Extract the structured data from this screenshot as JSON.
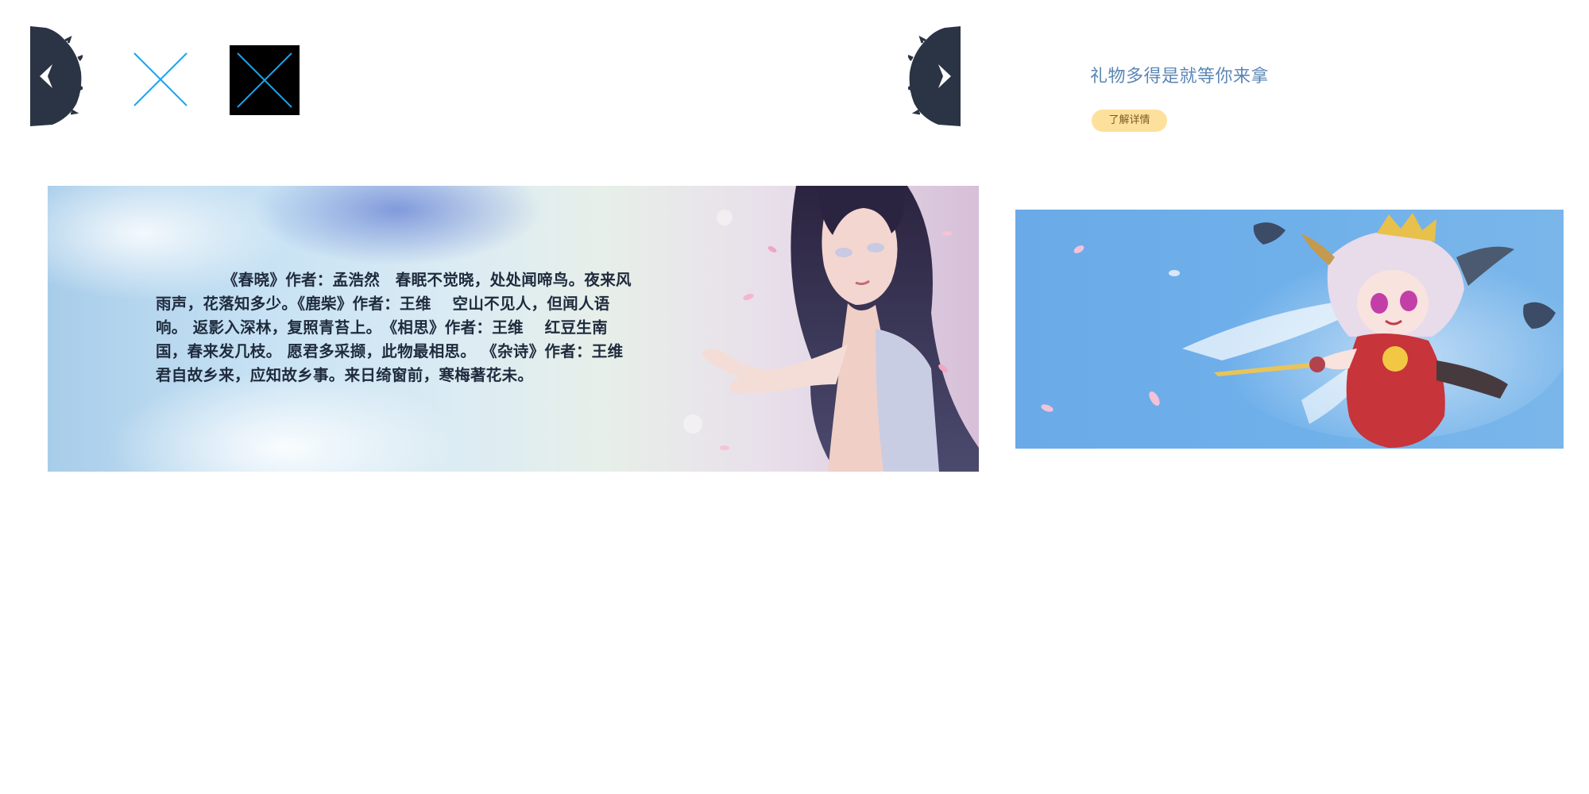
{
  "top_controls": {
    "prev_icon": "chevron-left-icon",
    "next_icon": "chevron-right-icon",
    "close_icon": "close-icon",
    "close_dark_icon": "close-icon",
    "accent": "#1ca3ec",
    "tab_color": "#2b3444"
  },
  "promo": {
    "title": "礼物多得是就等你来拿",
    "detail_button": "了解详情",
    "title_color": "#5b86b4",
    "button_color": "#fde09b"
  },
  "banner_poem": {
    "text": "《春晓》作者：孟浩然　春眠不觉晓，处处闻啼鸟。夜来风雨声，花落知多少。《鹿柴》作者：王维　 空山不见人，但闻人语响。 返影入深林，复照青苔上。　《相思》作者：王维　 红豆生南国，春来发几枝。 愿君多采撷，此物最相思。 《杂诗》作者：王维　君自故乡来，应知故乡事。来日绮窗前，寒梅著花未。"
  },
  "banner_character": {
    "background": "#6aaae8"
  }
}
